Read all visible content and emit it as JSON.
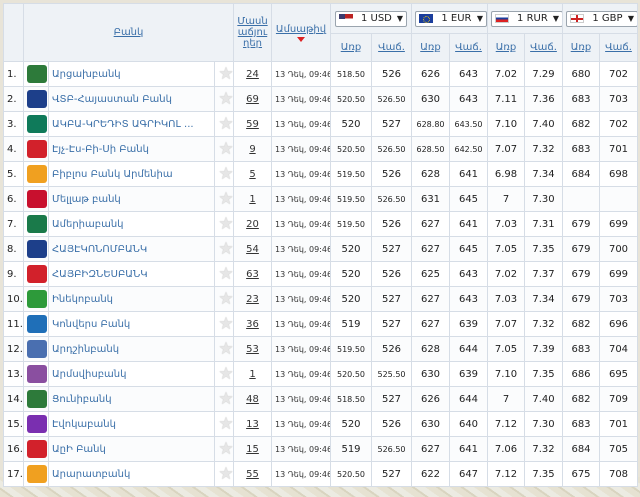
{
  "header": {
    "bank": "Բանկ",
    "sort": "Մասնաճյուղեր",
    "updated": "Ամսաթիվ",
    "buy": "Առք",
    "sell": "Վաճ.",
    "currencies": [
      {
        "code": "1 USD",
        "flag": "us-flag-icon"
      },
      {
        "code": "1 EUR",
        "flag": "eu-flag-icon"
      },
      {
        "code": "1 RUR",
        "flag": "ru-flag-icon"
      },
      {
        "code": "1 GBP",
        "flag": "gb-flag-icon"
      }
    ]
  },
  "colors": {
    "link": "#3a6fa8",
    "header_bg": "#eef2f6",
    "sort_arrow": "#dd2222"
  },
  "rows": [
    {
      "n": "1.",
      "name": "Արցախբանկ",
      "branches": "24",
      "date": "13 Դեկ, 09:46",
      "rates": [
        "518.50",
        "526",
        "626",
        "643",
        "7.02",
        "7.29",
        "680",
        "702"
      ],
      "logo_color": "#2d7a3a"
    },
    {
      "n": "2.",
      "name": "ՎՏԲ-Հայաստան Բանկ",
      "branches": "69",
      "date": "13 Դեկ, 09:46",
      "rates": [
        "520.50",
        "526.50",
        "630",
        "643",
        "7.11",
        "7.36",
        "683",
        "703"
      ],
      "logo_color": "#1d3f8a"
    },
    {
      "n": "3.",
      "name": "ԱԿԲԱ-ԿՐԵԴԻՏ ԱԳՐԻԿՈԼ ...",
      "branches": "59",
      "date": "13 Դեկ, 09:46",
      "rates": [
        "520",
        "527",
        "628.80",
        "643.50",
        "7.10",
        "7.40",
        "682",
        "702"
      ],
      "logo_color": "#0f7a5a"
    },
    {
      "n": "4.",
      "name": "Էյչ-Էս-Բի-Սի Բանկ",
      "branches": "9",
      "date": "13 Դեկ, 09:46",
      "rates": [
        "520.50",
        "526.50",
        "628.50",
        "642.50",
        "7.07",
        "7.32",
        "683",
        "701"
      ],
      "logo_color": "#d2212b"
    },
    {
      "n": "5.",
      "name": "Բիբլոս Բանկ Արմենիա",
      "branches": "5",
      "date": "13 Դեկ, 09:46",
      "rates": [
        "519.50",
        "526",
        "628",
        "641",
        "6.98",
        "7.34",
        "684",
        "698"
      ],
      "logo_color": "#f0a020"
    },
    {
      "n": "6.",
      "name": "Մելլաթ բանկ",
      "branches": "1",
      "date": "13 Դեկ, 09:46",
      "rates": [
        "519.50",
        "526.50",
        "631",
        "645",
        "7",
        "7.30",
        "",
        ""
      ],
      "logo_color": "#c8102e"
    },
    {
      "n": "7.",
      "name": "Ամերիաբանկ",
      "branches": "20",
      "date": "13 Դեկ, 09:46",
      "rates": [
        "519.50",
        "526",
        "627",
        "641",
        "7.03",
        "7.31",
        "679",
        "699"
      ],
      "logo_color": "#1a7a4a"
    },
    {
      "n": "8.",
      "name": "ՀԱՅԷԿՈՆՈՄԲԱՆԿ",
      "branches": "54",
      "date": "13 Դեկ, 09:46",
      "rates": [
        "520",
        "527",
        "627",
        "645",
        "7.05",
        "7.35",
        "679",
        "700"
      ],
      "logo_color": "#1d3f8a"
    },
    {
      "n": "9.",
      "name": "ՀԱՅԲԻԶՆԵՍԲԱՆԿ",
      "branches": "63",
      "date": "13 Դեկ, 09:46",
      "rates": [
        "520",
        "526",
        "625",
        "643",
        "7.02",
        "7.37",
        "679",
        "699"
      ],
      "logo_color": "#d2212b"
    },
    {
      "n": "10.",
      "name": "Ինեկոբանկ",
      "branches": "23",
      "date": "13 Դեկ, 09:46",
      "rates": [
        "520",
        "527",
        "627",
        "643",
        "7.03",
        "7.34",
        "679",
        "703"
      ],
      "logo_color": "#2d9a3a"
    },
    {
      "n": "11.",
      "name": "Կոնվերս Բանկ",
      "branches": "36",
      "date": "13 Դեկ, 09:46",
      "rates": [
        "519",
        "527",
        "627",
        "639",
        "7.07",
        "7.32",
        "682",
        "696"
      ],
      "logo_color": "#1f6fb8"
    },
    {
      "n": "12.",
      "name": "Արդշինբանկ",
      "branches": "53",
      "date": "13 Դեկ, 09:46",
      "rates": [
        "519.50",
        "526",
        "628",
        "644",
        "7.05",
        "7.39",
        "683",
        "704"
      ],
      "logo_color": "#4a6fb0"
    },
    {
      "n": "13.",
      "name": "Արմսվիսբանկ",
      "branches": "1",
      "date": "13 Դեկ, 09:46",
      "rates": [
        "520.50",
        "525.50",
        "630",
        "639",
        "7.10",
        "7.35",
        "686",
        "695"
      ],
      "logo_color": "#8a4fa0"
    },
    {
      "n": "14.",
      "name": "Ցունիբանկ",
      "branches": "48",
      "date": "13 Դեկ, 09:46",
      "rates": [
        "518.50",
        "527",
        "626",
        "644",
        "7",
        "7.40",
        "682",
        "709"
      ],
      "logo_color": "#2d7a3a"
    },
    {
      "n": "15.",
      "name": "Էվոկաբանկ",
      "branches": "13",
      "date": "13 Դեկ, 09:46",
      "rates": [
        "520",
        "526",
        "630",
        "640",
        "7.12",
        "7.30",
        "683",
        "701"
      ],
      "logo_color": "#7a2fb0"
    },
    {
      "n": "16.",
      "name": "ԱըԻ Բանկ",
      "branches": "15",
      "date": "13 Դեկ, 09:46",
      "rates": [
        "519",
        "526.50",
        "627",
        "641",
        "7.06",
        "7.32",
        "684",
        "705"
      ],
      "logo_color": "#d2212b"
    },
    {
      "n": "17.",
      "name": "Արարատբանկ",
      "branches": "55",
      "date": "13 Դեկ, 09:46",
      "rates": [
        "520.50",
        "527",
        "622",
        "647",
        "7.12",
        "7.35",
        "675",
        "708"
      ],
      "logo_color": "#f0a020"
    }
  ]
}
